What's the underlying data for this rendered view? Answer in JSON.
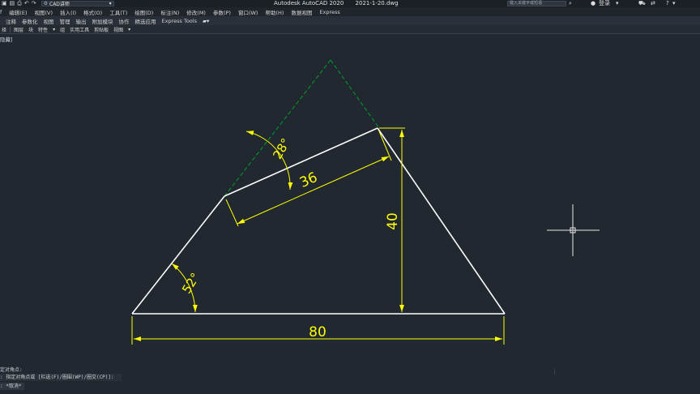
{
  "titlebar": {
    "workspace": "CAD讲师",
    "app_title": "Autodesk AutoCAD 2020",
    "file_name": "2021-1-20.dwg",
    "search_placeholder": "键入关键字或短语",
    "login": "登录"
  },
  "menu": [
    "f",
    "编辑(E)",
    "视图(V)",
    "插入(I)",
    "格式(O)",
    "工具(T)",
    "绘图(D)",
    "标注(N)",
    "修改(M)",
    "参数(P)",
    "窗口(W)",
    "帮助(H)",
    "数据视图",
    "Express"
  ],
  "ribbon_tabs": [
    "",
    "注释",
    "参数化",
    "视图",
    "管理",
    "输出",
    "附加模块",
    "协作",
    "精选应用",
    "Express Tools"
  ],
  "panel_bar": [
    "择",
    "图层",
    "块",
    "特性",
    "组",
    "实用工具",
    "剪贴板",
    "视图"
  ],
  "viewport_label": "隐藏]",
  "drawing": {
    "dimensions": {
      "base": "80",
      "height": "40",
      "top_edge": "36",
      "angle_left": "52°",
      "angle_top": "28°"
    },
    "colors": {
      "geometry": "#ffffff",
      "dimension": "#ffff00",
      "hidden": "#00a02a",
      "background": "#212830"
    }
  },
  "command_line": {
    "line1": "定对角点:",
    "line2": ": 指定对角点或 [栏选(F)/圈围(WP)/圈交(CP)]:",
    "line3": ": *取消*"
  }
}
